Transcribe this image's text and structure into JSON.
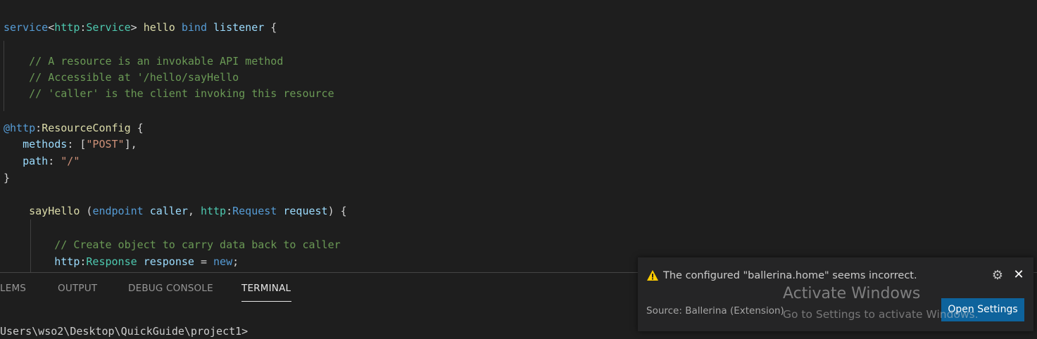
{
  "editor": {
    "lines": [
      {
        "tokens": [
          {
            "t": "keyword",
            "v": "service"
          },
          {
            "t": "plain",
            "v": "<"
          },
          {
            "t": "type",
            "v": "http"
          },
          {
            "t": "plain",
            "v": ":"
          },
          {
            "t": "type",
            "v": "Service"
          },
          {
            "t": "plain",
            "v": "> "
          },
          {
            "t": "func",
            "v": "hello"
          },
          {
            "t": "plain",
            "v": " "
          },
          {
            "t": "keyword",
            "v": "bind"
          },
          {
            "t": "plain",
            "v": " "
          },
          {
            "t": "var",
            "v": "listener"
          },
          {
            "t": "plain",
            "v": " {"
          }
        ]
      },
      {
        "tokens": [
          {
            "t": "comment",
            "v": "    // A resource is an invokable API method"
          }
        ]
      },
      {
        "tokens": [
          {
            "t": "comment",
            "v": "    // Accessible at '/hello/sayHello"
          }
        ]
      },
      {
        "tokens": [
          {
            "t": "comment",
            "v": "    // 'caller' is the client invoking this resource"
          }
        ]
      },
      {
        "tokens": [
          {
            "t": "keyword",
            "v": "@http"
          },
          {
            "t": "plain",
            "v": ":"
          },
          {
            "t": "func",
            "v": "ResourceConfig"
          },
          {
            "t": "plain",
            "v": " {"
          }
        ]
      },
      {
        "tokens": [
          {
            "t": "plain",
            "v": "   "
          },
          {
            "t": "var",
            "v": "methods"
          },
          {
            "t": "plain",
            "v": ": ["
          },
          {
            "t": "str",
            "v": "\"POST\""
          },
          {
            "t": "plain",
            "v": "],"
          }
        ]
      },
      {
        "tokens": [
          {
            "t": "plain",
            "v": "   "
          },
          {
            "t": "var",
            "v": "path"
          },
          {
            "t": "plain",
            "v": ": "
          },
          {
            "t": "str",
            "v": "\"/\""
          }
        ]
      },
      {
        "tokens": [
          {
            "t": "plain",
            "v": "}"
          }
        ]
      },
      {
        "tokens": [
          {
            "t": "plain",
            "v": "    "
          },
          {
            "t": "func",
            "v": "sayHello"
          },
          {
            "t": "plain",
            "v": " ("
          },
          {
            "t": "keyword",
            "v": "endpoint"
          },
          {
            "t": "plain",
            "v": " "
          },
          {
            "t": "var",
            "v": "caller"
          },
          {
            "t": "plain",
            "v": ", "
          },
          {
            "t": "type",
            "v": "http"
          },
          {
            "t": "plain",
            "v": ":"
          },
          {
            "t": "keyword",
            "v": "Request"
          },
          {
            "t": "plain",
            "v": " "
          },
          {
            "t": "var",
            "v": "request"
          },
          {
            "t": "plain",
            "v": ") {"
          }
        ]
      },
      {
        "tokens": [
          {
            "t": "comment",
            "v": "        // Create object to carry data back to caller"
          }
        ]
      },
      {
        "tokens": [
          {
            "t": "plain",
            "v": "        "
          },
          {
            "t": "var",
            "v": "http"
          },
          {
            "t": "plain",
            "v": ":"
          },
          {
            "t": "type",
            "v": "Response"
          },
          {
            "t": "plain",
            "v": " "
          },
          {
            "t": "var",
            "v": "response"
          },
          {
            "t": "plain",
            "v": " = "
          },
          {
            "t": "keyword",
            "v": "new"
          },
          {
            "t": "plain",
            "v": ";"
          }
        ]
      }
    ]
  },
  "panel": {
    "tabs": [
      {
        "label": "LEMS",
        "active": false
      },
      {
        "label": "OUTPUT",
        "active": false
      },
      {
        "label": "DEBUG CONSOLE",
        "active": false
      },
      {
        "label": "TERMINAL",
        "active": true
      }
    ],
    "terminal_prompt": "Users\\wso2\\Desktop\\QuickGuide\\project1>"
  },
  "notification": {
    "message": "The configured \"ballerina.home\" seems incorrect.",
    "source": "Source: Ballerina (Extension)",
    "button_label": "Open Settings",
    "icons": [
      "warning-icon",
      "gear-icon",
      "close-icon"
    ]
  },
  "watermark": {
    "title": "Activate Windows",
    "subtitle": "Go to Settings to activate Windows."
  },
  "colors": {
    "background": "#1e1e1e",
    "keyword": "#569cd6",
    "type": "#4ec9b0",
    "function": "#dcdcaa",
    "variable": "#9cdcfe",
    "string": "#ce9178",
    "comment": "#6a9955",
    "button": "#0e639c",
    "warning": "#ffcc00"
  }
}
